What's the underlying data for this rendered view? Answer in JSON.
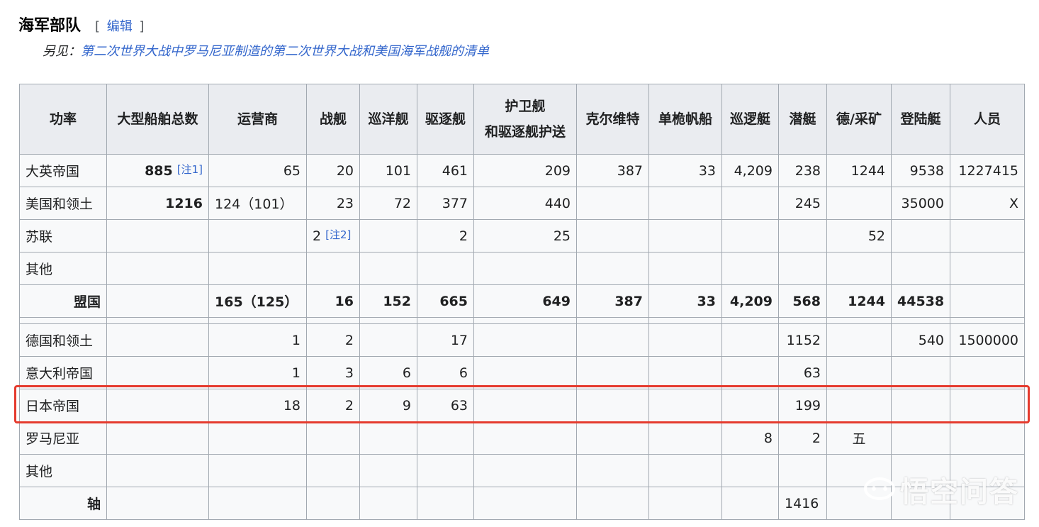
{
  "section": {
    "title": "海军部队",
    "edit_open": "[",
    "edit_label": "编辑",
    "edit_close": "]"
  },
  "hatnote": {
    "prefix": "另见：",
    "link1": "第二次世界大战中罗马尼亚制造的第二次世界大战",
    "conj": "和",
    "link2": "美国海军战舰的清单"
  },
  "table": {
    "headers": [
      "功率",
      "大型船舶总数",
      "运营商",
      "战舰",
      "巡洋舰",
      "驱逐舰",
      "护卫舰",
      "和驱逐舰护送",
      "克尔维特",
      "单桅帆船",
      "巡逻艇",
      "潜艇",
      "德/采矿",
      "登陆艇",
      "人员"
    ],
    "rows": [
      [
        "大英帝国",
        "885",
        "65",
        "20",
        "101",
        "461",
        "209",
        "387",
        "33",
        "4,209",
        "238",
        "1244",
        "9538",
        "1227415"
      ],
      [
        "美国和领土",
        "1216",
        "124（101）",
        "23",
        "72",
        "377",
        "440",
        "",
        "",
        "",
        "245",
        "",
        "35000",
        "X"
      ],
      [
        "苏联",
        "",
        "",
        "2",
        "",
        "2",
        "25",
        "",
        "",
        "",
        "",
        "52",
        "",
        "",
        ""
      ],
      [
        "其他",
        "",
        "",
        "",
        "",
        "",
        "",
        "",
        "",
        "",
        "",
        "",
        "",
        ""
      ],
      [
        "盟国",
        "",
        "165（125）",
        "16",
        "152",
        "665",
        "649",
        "387",
        "33",
        "4,209",
        "568",
        "1244",
        "44538",
        ""
      ],
      [
        "德国和领土",
        "",
        "1",
        "2",
        "",
        "17",
        "",
        "",
        "",
        "",
        "1152",
        "",
        "540",
        "1500000"
      ],
      [
        "意大利帝国",
        "",
        "1",
        "3",
        "6",
        "6",
        "",
        "",
        "",
        "",
        "63",
        "",
        "",
        ""
      ],
      [
        "日本帝国",
        "",
        "18",
        "2",
        "9",
        "63",
        "",
        "",
        "",
        "",
        "199",
        "",
        "",
        ""
      ],
      [
        "罗马尼亚",
        "",
        "",
        "",
        "",
        "",
        "",
        "",
        "",
        "8",
        "2",
        "五",
        "",
        ""
      ],
      [
        "其他",
        "",
        "",
        "",
        "",
        "",
        "",
        "",
        "",
        "",
        "",
        "",
        "",
        ""
      ],
      [
        "轴",
        "",
        "",
        "",
        "",
        "",
        "",
        "",
        "",
        "",
        "1416",
        "",
        "",
        ""
      ]
    ],
    "notes": {
      "note1": "[注1]",
      "note2": "[注2]"
    }
  },
  "watermark": {
    "text": "悟空问答"
  }
}
